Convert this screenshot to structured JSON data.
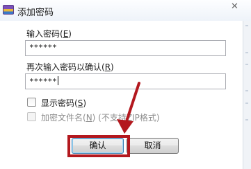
{
  "dialog": {
    "title": "添加密码",
    "close_symbol": "✕"
  },
  "password": {
    "label_prefix": "输入密码(",
    "label_accel": "E",
    "label_suffix": ")",
    "masked_value": "******"
  },
  "confirm_password": {
    "label_prefix": "再次输入密码以确认(",
    "label_accel": "R",
    "label_suffix": ")",
    "masked_value": "******"
  },
  "show_password": {
    "label_prefix": "显示密码(",
    "label_accel": "S",
    "label_suffix": ")",
    "checked": false,
    "enabled": true
  },
  "encrypt_filenames": {
    "label_prefix": "加密文件名(",
    "label_accel": "N",
    "label_suffix": ") (不支持ZIP格式)",
    "checked": false,
    "enabled": false
  },
  "buttons": {
    "ok_label": "确认",
    "cancel_label": "取消"
  },
  "annotation": {
    "color": "#b3181e"
  }
}
